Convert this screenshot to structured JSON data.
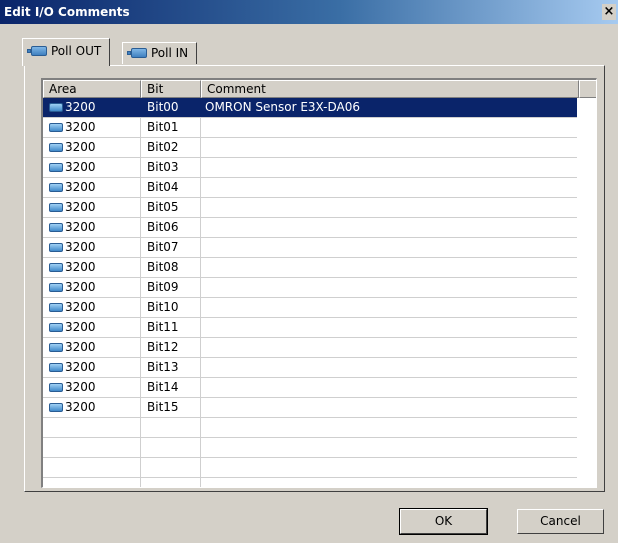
{
  "window": {
    "title": "Edit I/O Comments",
    "close_label": "×"
  },
  "tabs": [
    {
      "label": "Poll OUT",
      "active": true
    },
    {
      "label": "Poll IN",
      "active": false
    }
  ],
  "table": {
    "columns": [
      "Area",
      "Bit",
      "Comment"
    ],
    "rows": [
      {
        "area": "3200",
        "bit": "Bit00",
        "comment": "OMRON Sensor E3X-DA06",
        "selected": true
      },
      {
        "area": "3200",
        "bit": "Bit01",
        "comment": ""
      },
      {
        "area": "3200",
        "bit": "Bit02",
        "comment": ""
      },
      {
        "area": "3200",
        "bit": "Bit03",
        "comment": ""
      },
      {
        "area": "3200",
        "bit": "Bit04",
        "comment": ""
      },
      {
        "area": "3200",
        "bit": "Bit05",
        "comment": ""
      },
      {
        "area": "3200",
        "bit": "Bit06",
        "comment": ""
      },
      {
        "area": "3200",
        "bit": "Bit07",
        "comment": ""
      },
      {
        "area": "3200",
        "bit": "Bit08",
        "comment": ""
      },
      {
        "area": "3200",
        "bit": "Bit09",
        "comment": ""
      },
      {
        "area": "3200",
        "bit": "Bit10",
        "comment": ""
      },
      {
        "area": "3200",
        "bit": "Bit11",
        "comment": ""
      },
      {
        "area": "3200",
        "bit": "Bit12",
        "comment": ""
      },
      {
        "area": "3200",
        "bit": "Bit13",
        "comment": ""
      },
      {
        "area": "3200",
        "bit": "Bit14",
        "comment": ""
      },
      {
        "area": "3200",
        "bit": "Bit15",
        "comment": ""
      }
    ],
    "empty_rows": 3
  },
  "buttons": {
    "ok": "OK",
    "cancel": "Cancel"
  }
}
